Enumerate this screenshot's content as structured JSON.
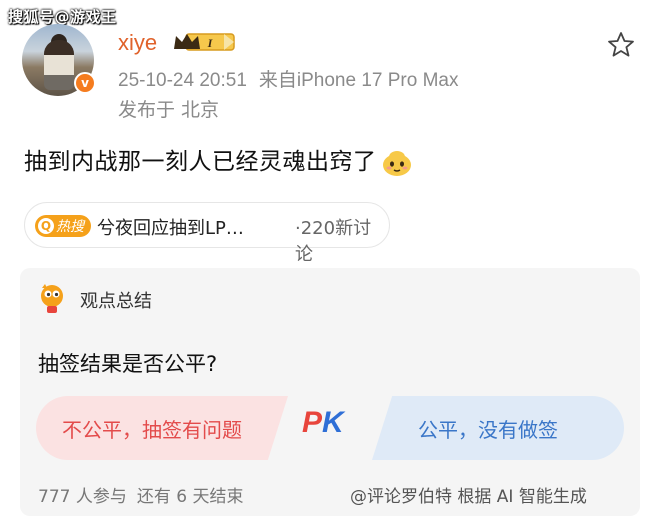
{
  "watermark": "搜狐号@游戏王",
  "author": {
    "name": "xiye",
    "level": "I",
    "verified": true
  },
  "meta": {
    "date": "25-10-24 20:51",
    "source": "来自iPhone 17 Pro Max",
    "location": "发布于 北京"
  },
  "post": {
    "text": "抽到内战那一刻人已经灵魂出窍了"
  },
  "hot_topic": {
    "tag": "热搜",
    "title": "兮夜回应抽到LP…",
    "count": "·220新讨论"
  },
  "summary": {
    "label": "观点总结",
    "question": "抽签结果是否公平?",
    "option_left": "不公平，抽签有问题",
    "option_right": "公平，没有做签",
    "pk": {
      "p": "P",
      "k": "K"
    },
    "participants": "777 人参与",
    "remaining": "还有 6 天结束",
    "attribution": "@评论罗伯特 根据 AI 智能生成"
  },
  "colors": {
    "username": "#e0622b",
    "hot_tag": "#f5a11a",
    "option_left_bg": "#fbe2e2",
    "option_left_text": "#e34b4b",
    "option_right_bg": "#dfeaf7",
    "option_right_text": "#3a76c8"
  },
  "icons": [
    "verified-badge-icon",
    "level-crown-icon",
    "star-icon",
    "emoji-icon",
    "search-q-icon",
    "mascot-icon"
  ]
}
